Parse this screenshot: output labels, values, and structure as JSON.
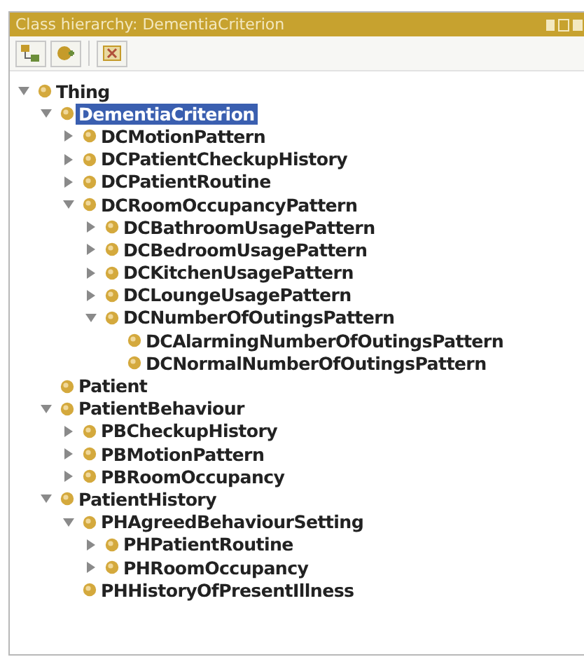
{
  "title_bar": {
    "title": "Class hierarchy: DementiaCriterion"
  },
  "tree": [
    {
      "label": "Thing",
      "selected": false,
      "expanded": true,
      "children": [
        {
          "label": "DementiaCriterion",
          "selected": true,
          "expanded": true,
          "children": [
            {
              "label": "DCMotionPattern",
              "selected": false,
              "expanded": false
            },
            {
              "label": "DCPatientCheckupHistory",
              "selected": false,
              "expanded": false
            },
            {
              "label": "DCPatientRoutine",
              "selected": false,
              "expanded": false
            },
            {
              "label": "DCRoomOccupancyPattern",
              "selected": false,
              "expanded": true,
              "children": [
                {
                  "label": "DCBathroomUsagePattern",
                  "selected": false,
                  "expanded": false
                },
                {
                  "label": "DCBedroomUsagePattern",
                  "selected": false,
                  "expanded": false
                },
                {
                  "label": "DCKitchenUsagePattern",
                  "selected": false,
                  "expanded": false
                },
                {
                  "label": "DCLoungeUsagePattern",
                  "selected": false,
                  "expanded": false
                },
                {
                  "label": "DCNumberOfOutingsPattern",
                  "selected": false,
                  "expanded": true,
                  "children": [
                    {
                      "label": "DCAlarmingNumberOfOutingsPattern",
                      "selected": false
                    },
                    {
                      "label": "DCNormalNumberOfOutingsPattern",
                      "selected": false
                    }
                  ]
                }
              ]
            }
          ]
        },
        {
          "label": "Patient",
          "selected": false
        },
        {
          "label": "PatientBehaviour",
          "selected": false,
          "expanded": true,
          "children": [
            {
              "label": "PBCheckupHistory",
              "selected": false,
              "expanded": false
            },
            {
              "label": "PBMotionPattern",
              "selected": false,
              "expanded": false
            },
            {
              "label": "PBRoomOccupancy",
              "selected": false,
              "expanded": false
            }
          ]
        },
        {
          "label": "PatientHistory",
          "selected": false,
          "expanded": true,
          "children": [
            {
              "label": "PHAgreedBehaviourSetting",
              "selected": false,
              "expanded": true,
              "children": [
                {
                  "label": "PHPatientRoutine",
                  "selected": false,
                  "expanded": false
                },
                {
                  "label": "PHRoomOccupancy",
                  "selected": false,
                  "expanded": false
                }
              ]
            },
            {
              "label": "PHHistoryOfPresentIllness",
              "selected": false
            }
          ]
        }
      ]
    }
  ]
}
